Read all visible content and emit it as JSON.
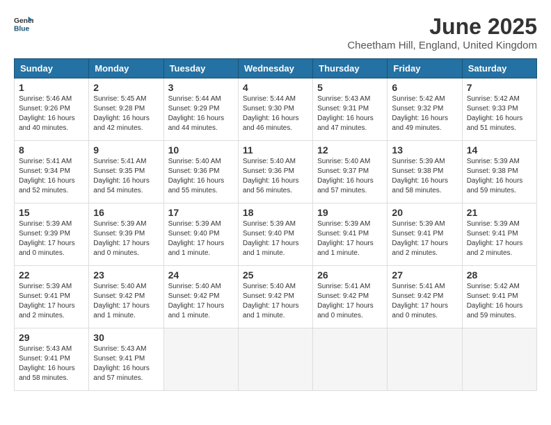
{
  "logo": {
    "general": "General",
    "blue": "Blue"
  },
  "title": "June 2025",
  "location": "Cheetham Hill, England, United Kingdom",
  "weekdays": [
    "Sunday",
    "Monday",
    "Tuesday",
    "Wednesday",
    "Thursday",
    "Friday",
    "Saturday"
  ],
  "days": [
    {
      "day": 1,
      "sunrise": "5:46 AM",
      "sunset": "9:26 PM",
      "daylight": "16 hours and 40 minutes."
    },
    {
      "day": 2,
      "sunrise": "5:45 AM",
      "sunset": "9:28 PM",
      "daylight": "16 hours and 42 minutes."
    },
    {
      "day": 3,
      "sunrise": "5:44 AM",
      "sunset": "9:29 PM",
      "daylight": "16 hours and 44 minutes."
    },
    {
      "day": 4,
      "sunrise": "5:44 AM",
      "sunset": "9:30 PM",
      "daylight": "16 hours and 46 minutes."
    },
    {
      "day": 5,
      "sunrise": "5:43 AM",
      "sunset": "9:31 PM",
      "daylight": "16 hours and 47 minutes."
    },
    {
      "day": 6,
      "sunrise": "5:42 AM",
      "sunset": "9:32 PM",
      "daylight": "16 hours and 49 minutes."
    },
    {
      "day": 7,
      "sunrise": "5:42 AM",
      "sunset": "9:33 PM",
      "daylight": "16 hours and 51 minutes."
    },
    {
      "day": 8,
      "sunrise": "5:41 AM",
      "sunset": "9:34 PM",
      "daylight": "16 hours and 52 minutes."
    },
    {
      "day": 9,
      "sunrise": "5:41 AM",
      "sunset": "9:35 PM",
      "daylight": "16 hours and 54 minutes."
    },
    {
      "day": 10,
      "sunrise": "5:40 AM",
      "sunset": "9:36 PM",
      "daylight": "16 hours and 55 minutes."
    },
    {
      "day": 11,
      "sunrise": "5:40 AM",
      "sunset": "9:36 PM",
      "daylight": "16 hours and 56 minutes."
    },
    {
      "day": 12,
      "sunrise": "5:40 AM",
      "sunset": "9:37 PM",
      "daylight": "16 hours and 57 minutes."
    },
    {
      "day": 13,
      "sunrise": "5:39 AM",
      "sunset": "9:38 PM",
      "daylight": "16 hours and 58 minutes."
    },
    {
      "day": 14,
      "sunrise": "5:39 AM",
      "sunset": "9:38 PM",
      "daylight": "16 hours and 59 minutes."
    },
    {
      "day": 15,
      "sunrise": "5:39 AM",
      "sunset": "9:39 PM",
      "daylight": "17 hours and 0 minutes."
    },
    {
      "day": 16,
      "sunrise": "5:39 AM",
      "sunset": "9:39 PM",
      "daylight": "17 hours and 0 minutes."
    },
    {
      "day": 17,
      "sunrise": "5:39 AM",
      "sunset": "9:40 PM",
      "daylight": "17 hours and 1 minute."
    },
    {
      "day": 18,
      "sunrise": "5:39 AM",
      "sunset": "9:40 PM",
      "daylight": "17 hours and 1 minute."
    },
    {
      "day": 19,
      "sunrise": "5:39 AM",
      "sunset": "9:41 PM",
      "daylight": "17 hours and 1 minute."
    },
    {
      "day": 20,
      "sunrise": "5:39 AM",
      "sunset": "9:41 PM",
      "daylight": "17 hours and 2 minutes."
    },
    {
      "day": 21,
      "sunrise": "5:39 AM",
      "sunset": "9:41 PM",
      "daylight": "17 hours and 2 minutes."
    },
    {
      "day": 22,
      "sunrise": "5:39 AM",
      "sunset": "9:41 PM",
      "daylight": "17 hours and 2 minutes."
    },
    {
      "day": 23,
      "sunrise": "5:40 AM",
      "sunset": "9:42 PM",
      "daylight": "17 hours and 1 minute."
    },
    {
      "day": 24,
      "sunrise": "5:40 AM",
      "sunset": "9:42 PM",
      "daylight": "17 hours and 1 minute."
    },
    {
      "day": 25,
      "sunrise": "5:40 AM",
      "sunset": "9:42 PM",
      "daylight": "17 hours and 1 minute."
    },
    {
      "day": 26,
      "sunrise": "5:41 AM",
      "sunset": "9:42 PM",
      "daylight": "17 hours and 0 minutes."
    },
    {
      "day": 27,
      "sunrise": "5:41 AM",
      "sunset": "9:42 PM",
      "daylight": "17 hours and 0 minutes."
    },
    {
      "day": 28,
      "sunrise": "5:42 AM",
      "sunset": "9:41 PM",
      "daylight": "16 hours and 59 minutes."
    },
    {
      "day": 29,
      "sunrise": "5:43 AM",
      "sunset": "9:41 PM",
      "daylight": "16 hours and 58 minutes."
    },
    {
      "day": 30,
      "sunrise": "5:43 AM",
      "sunset": "9:41 PM",
      "daylight": "16 hours and 57 minutes."
    }
  ]
}
